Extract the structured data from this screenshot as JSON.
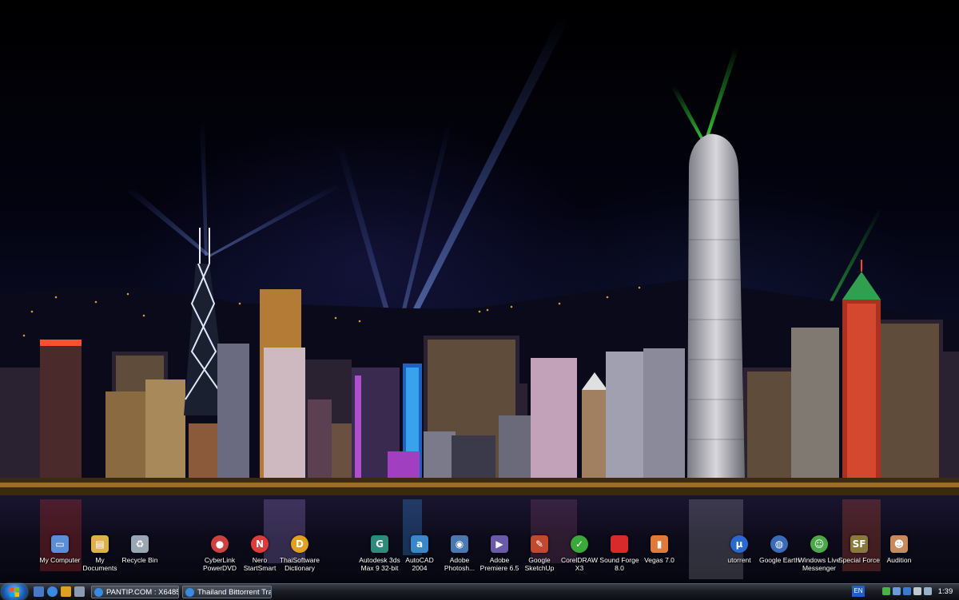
{
  "desktop": {
    "icons": [
      {
        "name": "my-computer",
        "label": "My Computer",
        "icon": "computer-icon",
        "color": "#5a8fd8"
      },
      {
        "name": "my-documents",
        "label": "My\nDocuments",
        "icon": "folder-icon",
        "color": "#d9b24a"
      },
      {
        "name": "recycle-bin",
        "label": "Recycle Bin",
        "icon": "recycle-bin-icon",
        "color": "#9aa6b4"
      },
      {
        "name": "cyberlink-powerdvd",
        "label": "CyberLink\nPowerDVD",
        "icon": "powerdvd-icon",
        "color": "#d04040"
      },
      {
        "name": "nero-startsmart",
        "label": "Nero\nStartSmart",
        "icon": "nero-icon",
        "color": "#e23a3a"
      },
      {
        "name": "thaisoftware-dictionary",
        "label": "ThaiSoftware\nDictionary",
        "icon": "dictionary-icon",
        "color": "#e0a020"
      },
      {
        "name": "autodesk-3ds-max",
        "label": "Autodesk 3ds\nMax 9 32-bit",
        "icon": "3ds-max-icon",
        "color": "#2e8a7a"
      },
      {
        "name": "autocad-2004",
        "label": "AutoCAD\n2004",
        "icon": "autocad-icon",
        "color": "#3a86c8"
      },
      {
        "name": "adobe-photoshop",
        "label": "Adobe\nPhotosh...",
        "icon": "photoshop-icon",
        "color": "#4a78b0"
      },
      {
        "name": "adobe-premiere",
        "label": "Adobe\nPremiere 6.5",
        "icon": "premiere-icon",
        "color": "#6a5aa8"
      },
      {
        "name": "google-sketchup",
        "label": "Google\nSketchUp",
        "icon": "sketchup-icon",
        "color": "#c04a30"
      },
      {
        "name": "coreldraw-x3",
        "label": "CorelDRAW\nX3",
        "icon": "coreldraw-icon",
        "color": "#3aa83a"
      },
      {
        "name": "sound-forge",
        "label": "Sound Forge\n8.0",
        "icon": "sound-forge-icon",
        "color": "#d82a2a"
      },
      {
        "name": "vegas-7",
        "label": "Vegas 7.0",
        "icon": "vegas-icon",
        "color": "#e07a3a"
      },
      {
        "name": "utorrent",
        "label": "utorrent",
        "icon": "utorrent-icon",
        "color": "#2a6ad0"
      },
      {
        "name": "google-earth",
        "label": "Google Earth",
        "icon": "google-earth-icon",
        "color": "#3a6ab8"
      },
      {
        "name": "windows-live-messenger",
        "label": "Windows Live\nMessenger",
        "icon": "messenger-icon",
        "color": "#4aa84a"
      },
      {
        "name": "special-force",
        "label": "Special Force",
        "icon": "special-force-icon",
        "color": "#8a7a3a"
      },
      {
        "name": "audition",
        "label": "Audition",
        "icon": "audition-icon",
        "color": "#c88a5a"
      }
    ]
  },
  "taskbar": {
    "start_icon": "windows-logo-icon",
    "quick_launch": [
      {
        "name": "show-desktop",
        "icon": "show-desktop-icon",
        "color": "#4a78c8"
      },
      {
        "name": "internet-explorer",
        "icon": "internet-explorer-icon",
        "color": "#3a8ae0"
      },
      {
        "name": "winamp",
        "icon": "winamp-icon",
        "color": "#e0a020"
      },
      {
        "name": "media-player",
        "icon": "media-player-icon",
        "color": "#8a9ab0"
      }
    ],
    "tasks": [
      {
        "name": "task-pantip",
        "label": "PANTIP.COM : X6485...",
        "icon": "internet-explorer-icon"
      },
      {
        "name": "task-thailand-bittorrent",
        "label": "Thailand Bittorrent Tra...",
        "icon": "internet-explorer-icon"
      }
    ],
    "language": "EN",
    "tray_icons": [
      {
        "name": "network",
        "icon": "network-icon",
        "color": "#4ab04a"
      },
      {
        "name": "antivirus",
        "icon": "antivirus-icon",
        "color": "#6a9ad8"
      },
      {
        "name": "bluetooth",
        "icon": "bluetooth-icon",
        "color": "#3a7ad0"
      },
      {
        "name": "volume",
        "icon": "volume-icon",
        "color": "#c0c8d0"
      },
      {
        "name": "safely-remove",
        "icon": "safely-remove-icon",
        "color": "#9ab0c8"
      }
    ],
    "clock": "1:39"
  }
}
